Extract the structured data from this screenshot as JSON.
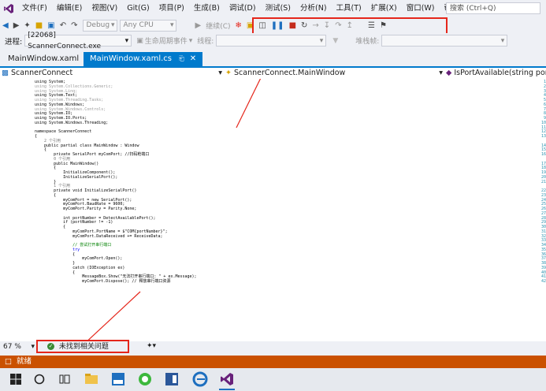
{
  "menu": [
    "文件(F)",
    "编辑(E)",
    "视图(V)",
    "Git(G)",
    "项目(P)",
    "生成(B)",
    "调试(D)",
    "测试(S)",
    "分析(N)",
    "工具(T)",
    "扩展(X)",
    "窗口(W)",
    "帮助(H)"
  ],
  "search_placeholder": "搜索 (Ctrl+Q)",
  "toolbar": {
    "config": "Debug",
    "platform": "Any CPU",
    "continue": "继续(C)"
  },
  "toolbar2": {
    "process_label": "进程:",
    "process_value": "[22068] ScannerConnect.exe",
    "lifecycle": "生命周期事件",
    "thread_label": "线程:",
    "stack_label": "堆栈帧:"
  },
  "tabs": [
    {
      "label": "MainWindow.xaml"
    },
    {
      "label": "MainWindow.xaml.cs"
    }
  ],
  "nav": {
    "project": "ScannerConnect",
    "class": "ScannerConnect.MainWindow",
    "member": "IsPortAvailable(string portNa"
  },
  "lines": [
    {
      "n": "1",
      "t": "using System;",
      "c": "#000"
    },
    {
      "n": "2",
      "t": "using System.Collections.Generic;",
      "c": "#999"
    },
    {
      "n": "3",
      "t": "using System.Linq;",
      "c": "#999"
    },
    {
      "n": "4",
      "t": "using System.Text;",
      "c": "#000"
    },
    {
      "n": "5",
      "t": "using System.Threading.Tasks;",
      "c": "#999"
    },
    {
      "n": "6",
      "t": "using System.Windows;",
      "c": "#000"
    },
    {
      "n": "7",
      "t": "using System.Windows.Controls;",
      "c": "#999"
    },
    {
      "n": "8",
      "t": "using System.IO;",
      "c": "#000"
    },
    {
      "n": "9",
      "t": "using System.IO.Ports;",
      "c": "#000"
    },
    {
      "n": "10",
      "t": "using System.Windows.Threading;",
      "c": "#000"
    },
    {
      "n": "11",
      "t": "",
      "c": "#000"
    },
    {
      "n": "12",
      "t": "namespace ScannerConnect",
      "c": "#000"
    },
    {
      "n": "13",
      "t": "{",
      "c": "#000"
    },
    {
      "n": "",
      "t": "    2 个引用",
      "c": "#777"
    },
    {
      "n": "14",
      "t": "    public partial class MainWindow : Window",
      "c": "#000"
    },
    {
      "n": "15",
      "t": "    {",
      "c": "#000"
    },
    {
      "n": "16",
      "t": "        private SerialPort myComPort; //扫码枪端口",
      "c": "#000"
    },
    {
      "n": "",
      "t": "        0 个引用",
      "c": "#777"
    },
    {
      "n": "17",
      "t": "        public MainWindow()",
      "c": "#000"
    },
    {
      "n": "18",
      "t": "        {",
      "c": "#000"
    },
    {
      "n": "19",
      "t": "            InitializeComponent();",
      "c": "#000"
    },
    {
      "n": "20",
      "t": "            InitializeSerialPort();",
      "c": "#000"
    },
    {
      "n": "21",
      "t": "        }",
      "c": "#000"
    },
    {
      "n": "",
      "t": "        1 个引用",
      "c": "#777"
    },
    {
      "n": "22",
      "t": "        private void InitializeSerialPort()",
      "c": "#000"
    },
    {
      "n": "23",
      "t": "        {",
      "c": "#000"
    },
    {
      "n": "24",
      "t": "            myComPort = new SerialPort();",
      "c": "#000"
    },
    {
      "n": "25",
      "t": "            myComPort.BaudRate = 9600;",
      "c": "#000"
    },
    {
      "n": "26",
      "t": "            myComPort.Parity = Parity.None;",
      "c": "#000"
    },
    {
      "n": "27",
      "t": "",
      "c": "#000"
    },
    {
      "n": "28",
      "t": "            int portNumber = DetectAvailablePort();",
      "c": "#000"
    },
    {
      "n": "29",
      "t": "            if (portNumber != -1)",
      "c": "#000"
    },
    {
      "n": "30",
      "t": "            {",
      "c": "#000"
    },
    {
      "n": "31",
      "t": "                myComPort.PortName = $\"COM{portNumber}\";",
      "c": "#000"
    },
    {
      "n": "32",
      "t": "                myComPort.DataReceived += ReceiveData;",
      "c": "#000"
    },
    {
      "n": "33",
      "t": "",
      "c": "#000"
    },
    {
      "n": "34",
      "t": "                // 尝试打开串行端口",
      "c": "#008000"
    },
    {
      "n": "35",
      "t": "                try",
      "c": "#0000ff"
    },
    {
      "n": "36",
      "t": "                {",
      "c": "#000"
    },
    {
      "n": "37",
      "t": "                    myComPort.Open();",
      "c": "#000"
    },
    {
      "n": "38",
      "t": "                }",
      "c": "#000"
    },
    {
      "n": "39",
      "t": "                catch (IOException ex)",
      "c": "#000"
    },
    {
      "n": "40",
      "t": "                {",
      "c": "#000"
    },
    {
      "n": "41",
      "t": "                    MessageBox.Show(\"无法打开串行端口: \" + ex.Message);",
      "c": "#000"
    },
    {
      "n": "42",
      "t": "                    myComPort.Dispose(); // 释放串行端口资源",
      "c": "#000"
    }
  ],
  "edit_status": {
    "zoom": "67 %",
    "issues": "未找到相关问题"
  },
  "status": {
    "text": "就绪"
  }
}
